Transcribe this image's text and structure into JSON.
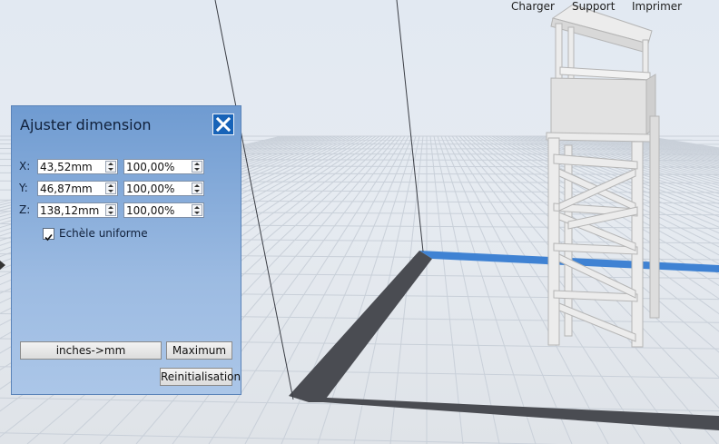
{
  "top_menu": {
    "charger": "Charger",
    "support": "Support",
    "imprimer": "Imprimer"
  },
  "dialog": {
    "title": "Ajuster dimension",
    "rows": [
      {
        "axis": "X:",
        "size": "43,52mm",
        "scale": "100,00%"
      },
      {
        "axis": "Y:",
        "size": "46,87mm",
        "scale": "100,00%"
      },
      {
        "axis": "Z:",
        "size": "138,12mm",
        "scale": "100,00%"
      }
    ],
    "uniform_label": "Echèle uniforme",
    "uniform_checked": true,
    "inches_button": "inches->mm",
    "maximum_button": "Maximum",
    "reset_button": "Reinitialisation"
  },
  "colors": {
    "accent": "#1763b8",
    "bed_edge": "#4a4c52",
    "axis_blue": "#3f82d3"
  }
}
